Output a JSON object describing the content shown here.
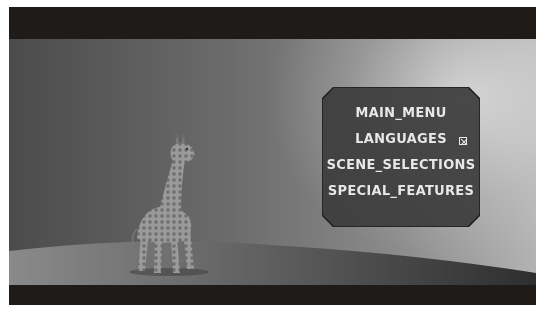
{
  "menu": {
    "items": [
      {
        "label": "MAIN_MENU"
      },
      {
        "label": "LANGUAGES"
      },
      {
        "label": "SCENE_SELECTIONS"
      },
      {
        "label": "SPECIAL_FEATURES"
      }
    ],
    "selected_index": 0,
    "selector_icon": "checkbox-x-icon",
    "text_color": "#e8e8e8",
    "panel_color": "#3c3c3c"
  },
  "scene": {
    "subject_icon": "giraffe-toy-icon"
  }
}
